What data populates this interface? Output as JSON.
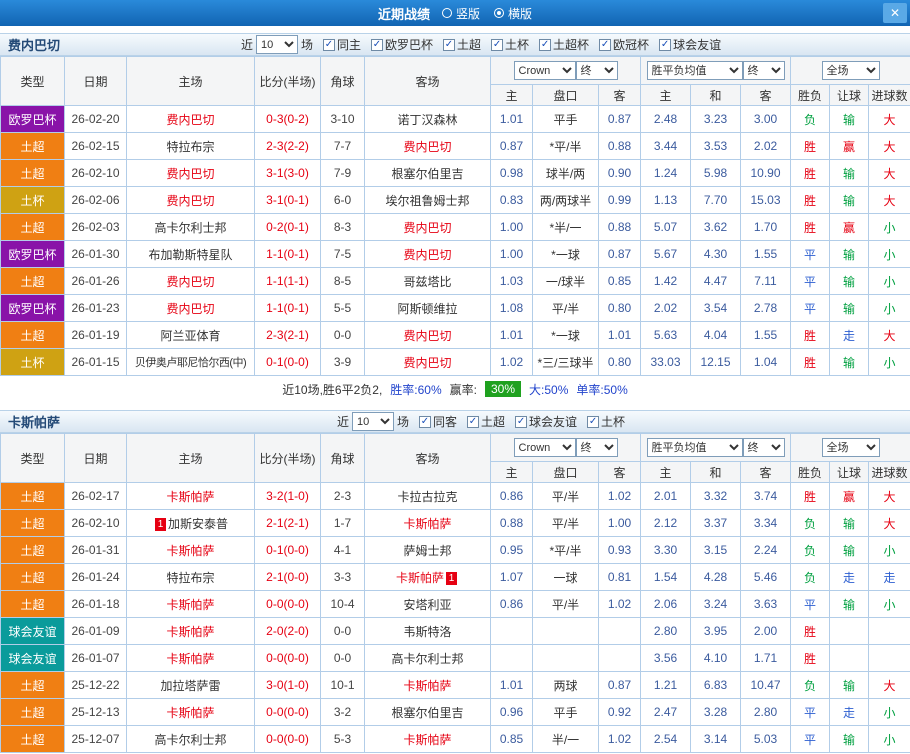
{
  "topbar": {
    "title": "近期战绩",
    "close": "✕",
    "options": [
      {
        "label": "竖版",
        "selected": false
      },
      {
        "label": "横版",
        "selected": true
      }
    ]
  },
  "table_headers": {
    "type": "类型",
    "date": "日期",
    "home": "主场",
    "score": "比分(半场)",
    "corner": "角球",
    "away": "客场",
    "asia_home": "主",
    "asia_line": "盘口",
    "asia_away": "客",
    "eu_home": "主",
    "eu_draw": "和",
    "eu_away": "客",
    "result": "胜负",
    "asia_result": "让球",
    "goal_result": "进球数"
  },
  "type_colors": {
    "欧罗巴杯": "#8913a8",
    "土超": "#f07f13",
    "土杯": "#cfa213",
    "球会友谊": "#0a9b9b"
  },
  "result_colors": {
    "win": "#e60012",
    "draw": "#2d5fd0",
    "lose": "#00a040"
  },
  "sections": [
    {
      "team": "费内巴切",
      "filter_prefix": "近",
      "games": "10",
      "filter_suffix": "场",
      "checkboxes": [
        {
          "label": "同主",
          "checked": true
        },
        {
          "label": "欧罗巴杯",
          "checked": true
        },
        {
          "label": "土超",
          "checked": true
        },
        {
          "label": "土杯",
          "checked": true
        },
        {
          "label": "土超杯",
          "checked": true
        },
        {
          "label": "欧冠杯",
          "checked": true
        },
        {
          "label": "球会友谊",
          "checked": true
        }
      ],
      "selects": {
        "company": "Crown",
        "company_stage": "终",
        "metric": "胜平负均值",
        "metric_stage": "终",
        "scope": "全场"
      },
      "rows": [
        {
          "league": "欧罗巴杯",
          "date": "26-02-20",
          "home": {
            "name": "费内巴切",
            "hl": true
          },
          "score": "0-3(0-2)",
          "corner": "3-10",
          "away": {
            "name": "诺丁汉森林",
            "hl": false
          },
          "ah": "1.01",
          "line": "平手",
          "aa": "0.87",
          "eh": "2.48",
          "ed": "3.23",
          "ea": "3.00",
          "res": {
            "t": "负",
            "c": "lose"
          },
          "ares": {
            "t": "输",
            "c": "lose"
          },
          "gres": {
            "t": "大",
            "c": "win"
          }
        },
        {
          "league": "土超",
          "date": "26-02-15",
          "home": {
            "name": "特拉布宗",
            "hl": false
          },
          "score": "2-3(2-2)",
          "corner": "7-7",
          "away": {
            "name": "费内巴切",
            "hl": true
          },
          "ah": "0.87",
          "line": "*平/半",
          "aa": "0.88",
          "eh": "3.44",
          "ed": "3.53",
          "ea": "2.02",
          "res": {
            "t": "胜",
            "c": "win"
          },
          "ares": {
            "t": "赢",
            "c": "win"
          },
          "gres": {
            "t": "大",
            "c": "win"
          }
        },
        {
          "league": "土超",
          "date": "26-02-10",
          "home": {
            "name": "费内巴切",
            "hl": true
          },
          "score": "3-1(3-0)",
          "corner": "7-9",
          "away": {
            "name": "根塞尔伯里吉",
            "hl": false
          },
          "ah": "0.98",
          "line": "球半/两",
          "aa": "0.90",
          "eh": "1.24",
          "ed": "5.98",
          "ea": "10.90",
          "res": {
            "t": "胜",
            "c": "win"
          },
          "ares": {
            "t": "输",
            "c": "lose"
          },
          "gres": {
            "t": "大",
            "c": "win"
          }
        },
        {
          "league": "土杯",
          "date": "26-02-06",
          "home": {
            "name": "费内巴切",
            "hl": true
          },
          "score": "3-1(0-1)",
          "corner": "6-0",
          "away": {
            "name": "埃尔祖鲁姆士邦",
            "hl": false
          },
          "ah": "0.83",
          "line": "两/两球半",
          "aa": "0.99",
          "eh": "1.13",
          "ed": "7.70",
          "ea": "15.03",
          "res": {
            "t": "胜",
            "c": "win"
          },
          "ares": {
            "t": "输",
            "c": "lose"
          },
          "gres": {
            "t": "大",
            "c": "win"
          }
        },
        {
          "league": "土超",
          "date": "26-02-03",
          "home": {
            "name": "高卡尔利士邦",
            "hl": false
          },
          "score": "0-2(0-1)",
          "corner": "8-3",
          "away": {
            "name": "费内巴切",
            "hl": true
          },
          "ah": "1.00",
          "line": "*半/一",
          "aa": "0.88",
          "eh": "5.07",
          "ed": "3.62",
          "ea": "1.70",
          "res": {
            "t": "胜",
            "c": "win"
          },
          "ares": {
            "t": "赢",
            "c": "win"
          },
          "gres": {
            "t": "小",
            "c": "lose"
          }
        },
        {
          "league": "欧罗巴杯",
          "date": "26-01-30",
          "home": {
            "name": "布加勒斯特星队",
            "hl": false
          },
          "score": "1-1(0-1)",
          "corner": "7-5",
          "away": {
            "name": "费内巴切",
            "hl": true
          },
          "ah": "1.00",
          "line": "*一球",
          "aa": "0.87",
          "eh": "5.67",
          "ed": "4.30",
          "ea": "1.55",
          "res": {
            "t": "平",
            "c": "draw"
          },
          "ares": {
            "t": "输",
            "c": "lose"
          },
          "gres": {
            "t": "小",
            "c": "lose"
          }
        },
        {
          "league": "土超",
          "date": "26-01-26",
          "home": {
            "name": "费内巴切",
            "hl": true
          },
          "score": "1-1(1-1)",
          "corner": "8-5",
          "away": {
            "name": "哥兹塔比",
            "hl": false
          },
          "ah": "1.03",
          "line": "一/球半",
          "aa": "0.85",
          "eh": "1.42",
          "ed": "4.47",
          "ea": "7.11",
          "res": {
            "t": "平",
            "c": "draw"
          },
          "ares": {
            "t": "输",
            "c": "lose"
          },
          "gres": {
            "t": "小",
            "c": "lose"
          }
        },
        {
          "league": "欧罗巴杯",
          "date": "26-01-23",
          "home": {
            "name": "费内巴切",
            "hl": true
          },
          "score": "1-1(0-1)",
          "corner": "5-5",
          "away": {
            "name": "阿斯顿维拉",
            "hl": false
          },
          "ah": "1.08",
          "line": "平/半",
          "aa": "0.80",
          "eh": "2.02",
          "ed": "3.54",
          "ea": "2.78",
          "res": {
            "t": "平",
            "c": "draw"
          },
          "ares": {
            "t": "输",
            "c": "lose"
          },
          "gres": {
            "t": "小",
            "c": "lose"
          }
        },
        {
          "league": "土超",
          "date": "26-01-19",
          "home": {
            "name": "阿兰亚体育",
            "hl": false
          },
          "score": "2-3(2-1)",
          "corner": "0-0",
          "away": {
            "name": "费内巴切",
            "hl": true
          },
          "ah": "1.01",
          "line": "*一球",
          "aa": "1.01",
          "eh": "5.63",
          "ed": "4.04",
          "ea": "1.55",
          "res": {
            "t": "胜",
            "c": "win"
          },
          "ares": {
            "t": "走",
            "c": "draw"
          },
          "gres": {
            "t": "大",
            "c": "win"
          }
        },
        {
          "league": "土杯",
          "date": "26-01-15",
          "home": {
            "name": "贝伊奥卢耶尼恰尔西(中)",
            "hl": false
          },
          "score": "0-1(0-0)",
          "corner": "3-9",
          "away": {
            "name": "费内巴切",
            "hl": true
          },
          "ah": "1.02",
          "line": "*三/三球半",
          "aa": "0.80",
          "eh": "33.03",
          "ed": "12.15",
          "ea": "1.04",
          "res": {
            "t": "胜",
            "c": "win"
          },
          "ares": {
            "t": "输",
            "c": "lose"
          },
          "gres": {
            "t": "小",
            "c": "lose"
          }
        }
      ],
      "summary": [
        {
          "text": "近10场,胜6平2负2,",
          "style": "plain"
        },
        {
          "text": "胜率:60%",
          "style": "blue"
        },
        {
          "text": "赢率:",
          "style": "plain"
        },
        {
          "text": "30%",
          "style": "badge"
        },
        {
          "text": "大:50%",
          "style": "blue"
        },
        {
          "text": "单率:50%",
          "style": "blue"
        }
      ]
    },
    {
      "team": "卡斯帕萨",
      "filter_prefix": "近",
      "games": "10",
      "filter_suffix": "场",
      "checkboxes": [
        {
          "label": "同客",
          "checked": true
        },
        {
          "label": "土超",
          "checked": true
        },
        {
          "label": "球会友谊",
          "checked": true
        },
        {
          "label": "土杯",
          "checked": true
        }
      ],
      "selects": {
        "company": "Crown",
        "company_stage": "终",
        "metric": "胜平负均值",
        "metric_stage": "终",
        "scope": "全场"
      },
      "rows": [
        {
          "league": "土超",
          "date": "26-02-17",
          "home": {
            "name": "卡斯帕萨",
            "hl": true
          },
          "score": "3-2(1-0)",
          "corner": "2-3",
          "away": {
            "name": "卡拉古拉克",
            "hl": false
          },
          "ah": "0.86",
          "line": "平/半",
          "aa": "1.02",
          "eh": "2.01",
          "ed": "3.32",
          "ea": "3.74",
          "res": {
            "t": "胜",
            "c": "win"
          },
          "ares": {
            "t": "赢",
            "c": "win"
          },
          "gres": {
            "t": "大",
            "c": "win"
          }
        },
        {
          "league": "土超",
          "date": "26-02-10",
          "home": {
            "name": "加斯安泰普",
            "hl": false,
            "card": "1",
            "card_pos": "before"
          },
          "score": "2-1(2-1)",
          "corner": "1-7",
          "away": {
            "name": "卡斯帕萨",
            "hl": true
          },
          "ah": "0.88",
          "line": "平/半",
          "aa": "1.00",
          "eh": "2.12",
          "ed": "3.37",
          "ea": "3.34",
          "res": {
            "t": "负",
            "c": "lose"
          },
          "ares": {
            "t": "输",
            "c": "lose"
          },
          "gres": {
            "t": "大",
            "c": "win"
          }
        },
        {
          "league": "土超",
          "date": "26-01-31",
          "home": {
            "name": "卡斯帕萨",
            "hl": true
          },
          "score": "0-1(0-0)",
          "corner": "4-1",
          "away": {
            "name": "萨姆士邦",
            "hl": false
          },
          "ah": "0.95",
          "line": "*平/半",
          "aa": "0.93",
          "eh": "3.30",
          "ed": "3.15",
          "ea": "2.24",
          "res": {
            "t": "负",
            "c": "lose"
          },
          "ares": {
            "t": "输",
            "c": "lose"
          },
          "gres": {
            "t": "小",
            "c": "lose"
          }
        },
        {
          "league": "土超",
          "date": "26-01-24",
          "home": {
            "name": "特拉布宗",
            "hl": false
          },
          "score": "2-1(0-0)",
          "corner": "3-3",
          "away": {
            "name": "卡斯帕萨",
            "hl": true,
            "card": "1",
            "card_pos": "after"
          },
          "ah": "1.07",
          "line": "一球",
          "aa": "0.81",
          "eh": "1.54",
          "ed": "4.28",
          "ea": "5.46",
          "res": {
            "t": "负",
            "c": "lose"
          },
          "ares": {
            "t": "走",
            "c": "draw"
          },
          "gres": {
            "t": "走",
            "c": "draw"
          }
        },
        {
          "league": "土超",
          "date": "26-01-18",
          "home": {
            "name": "卡斯帕萨",
            "hl": true
          },
          "score": "0-0(0-0)",
          "corner": "10-4",
          "away": {
            "name": "安塔利亚",
            "hl": false
          },
          "ah": "0.86",
          "line": "平/半",
          "aa": "1.02",
          "eh": "2.06",
          "ed": "3.24",
          "ea": "3.63",
          "res": {
            "t": "平",
            "c": "draw"
          },
          "ares": {
            "t": "输",
            "c": "lose"
          },
          "gres": {
            "t": "小",
            "c": "lose"
          }
        },
        {
          "league": "球会友谊",
          "date": "26-01-09",
          "home": {
            "name": "卡斯帕萨",
            "hl": true
          },
          "score": "2-0(2-0)",
          "corner": "0-0",
          "away": {
            "name": "韦斯特洛",
            "hl": false
          },
          "ah": "",
          "line": "",
          "aa": "",
          "eh": "2.80",
          "ed": "3.95",
          "ea": "2.00",
          "res": {
            "t": "胜",
            "c": "win"
          },
          "ares": null,
          "gres": null
        },
        {
          "league": "球会友谊",
          "date": "26-01-07",
          "home": {
            "name": "卡斯帕萨",
            "hl": true
          },
          "score": "0-0(0-0)",
          "corner": "0-0",
          "away": {
            "name": "高卡尔利士邦",
            "hl": false
          },
          "ah": "",
          "line": "",
          "aa": "",
          "eh": "3.56",
          "ed": "4.10",
          "ea": "1.71",
          "res": {
            "t": "胜",
            "c": "win"
          },
          "ares": null,
          "gres": null
        },
        {
          "league": "土超",
          "date": "25-12-22",
          "home": {
            "name": "加拉塔萨雷",
            "hl": false
          },
          "score": "3-0(1-0)",
          "corner": "10-1",
          "away": {
            "name": "卡斯帕萨",
            "hl": true
          },
          "ah": "1.01",
          "line": "两球",
          "aa": "0.87",
          "eh": "1.21",
          "ed": "6.83",
          "ea": "10.47",
          "res": {
            "t": "负",
            "c": "lose"
          },
          "ares": {
            "t": "输",
            "c": "lose"
          },
          "gres": {
            "t": "大",
            "c": "win"
          }
        },
        {
          "league": "土超",
          "date": "25-12-13",
          "home": {
            "name": "卡斯帕萨",
            "hl": true
          },
          "score": "0-0(0-0)",
          "corner": "3-2",
          "away": {
            "name": "根塞尔伯里吉",
            "hl": false
          },
          "ah": "0.96",
          "line": "平手",
          "aa": "0.92",
          "eh": "2.47",
          "ed": "3.28",
          "ea": "2.80",
          "res": {
            "t": "平",
            "c": "draw"
          },
          "ares": {
            "t": "走",
            "c": "draw"
          },
          "gres": {
            "t": "小",
            "c": "lose"
          }
        },
        {
          "league": "土超",
          "date": "25-12-07",
          "home": {
            "name": "高卡尔利士邦",
            "hl": false
          },
          "score": "0-0(0-0)",
          "corner": "5-3",
          "away": {
            "name": "卡斯帕萨",
            "hl": true
          },
          "ah": "0.85",
          "line": "半/一",
          "aa": "1.02",
          "eh": "2.54",
          "ed": "3.14",
          "ea": "5.03",
          "res": {
            "t": "平",
            "c": "draw"
          },
          "ares": {
            "t": "输",
            "c": "lose"
          },
          "gres": {
            "t": "小",
            "c": "lose"
          }
        }
      ],
      "summary": null
    }
  ]
}
